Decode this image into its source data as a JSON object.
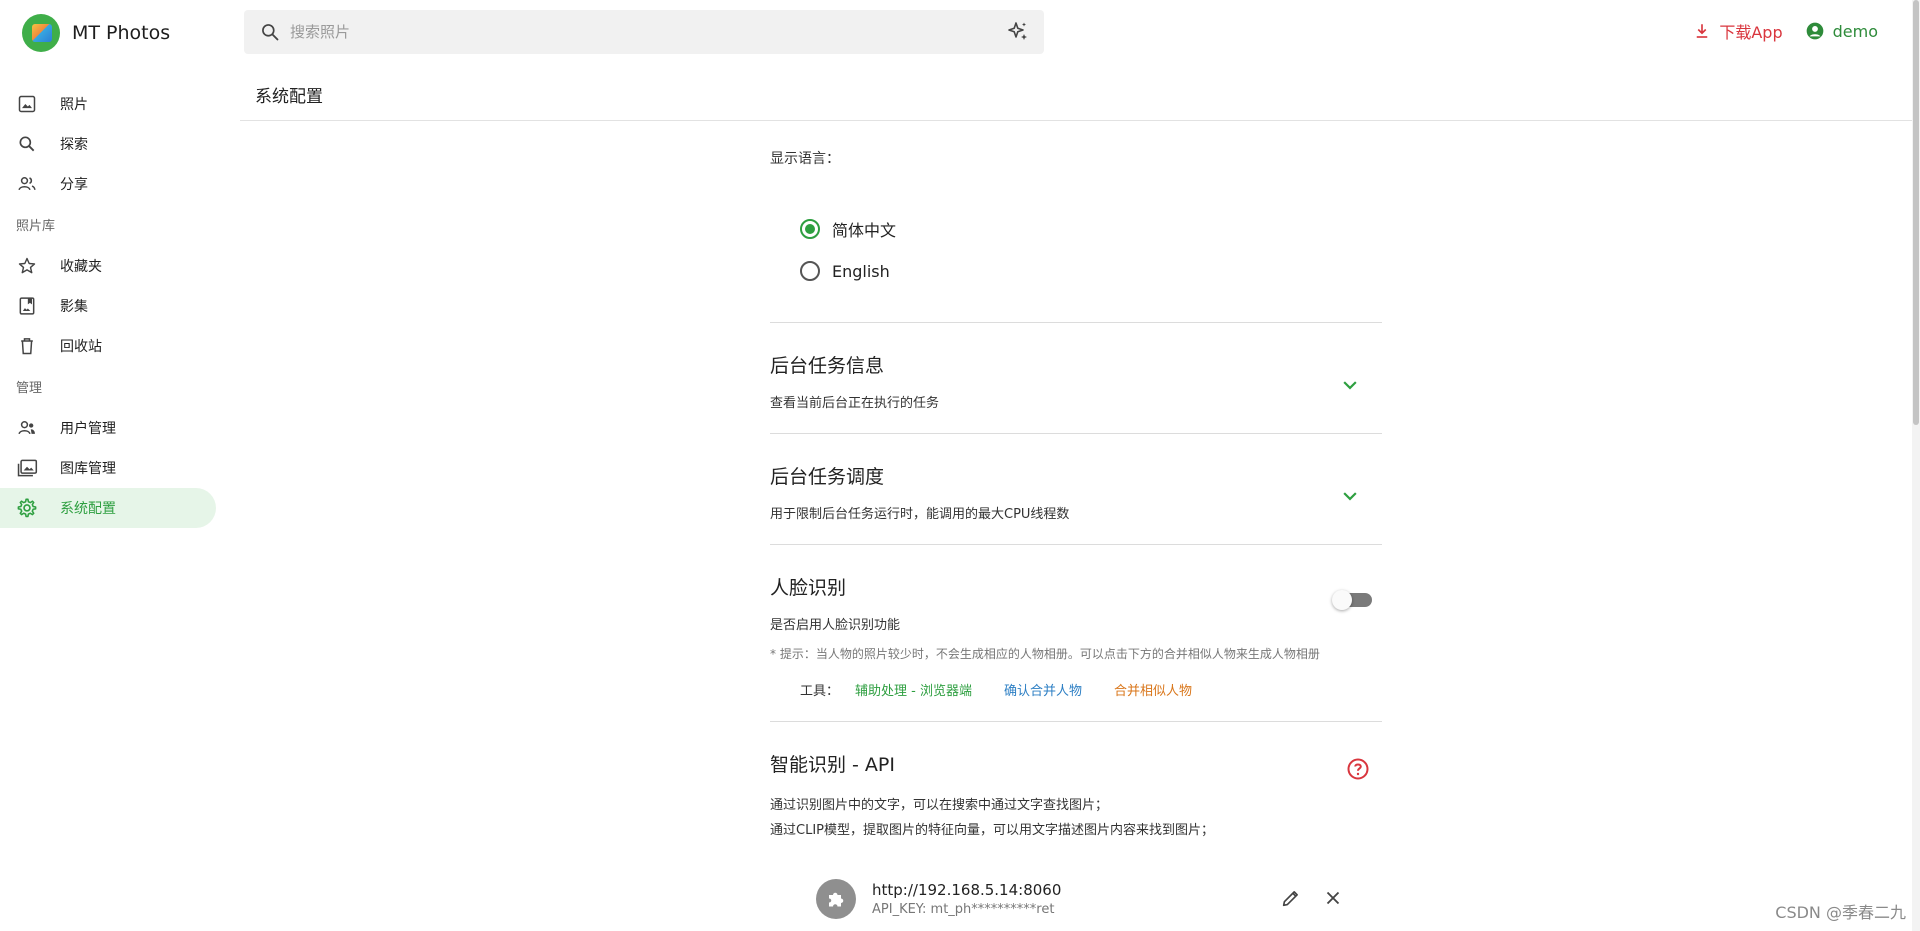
{
  "app": {
    "title": "MT Photos"
  },
  "search": {
    "placeholder": "搜索照片"
  },
  "header": {
    "download_label": "下载App",
    "user_name": "demo"
  },
  "sidebar": {
    "main": [
      {
        "label": "照片",
        "icon": "image-icon"
      },
      {
        "label": "探索",
        "icon": "search-icon"
      },
      {
        "label": "分享",
        "icon": "people-icon"
      }
    ],
    "library_label": "照片库",
    "library": [
      {
        "label": "收藏夹",
        "icon": "star-icon"
      },
      {
        "label": "影集",
        "icon": "album-icon"
      },
      {
        "label": "回收站",
        "icon": "trash-icon"
      }
    ],
    "admin_label": "管理",
    "admin": [
      {
        "label": "用户管理",
        "icon": "users-icon"
      },
      {
        "label": "图库管理",
        "icon": "gallery-icon"
      },
      {
        "label": "系统配置",
        "icon": "gear-icon",
        "active": true
      }
    ]
  },
  "page": {
    "title": "系统配置"
  },
  "language": {
    "label": "显示语言：",
    "options": [
      {
        "label": "简体中文",
        "checked": true
      },
      {
        "label": "English",
        "checked": false
      }
    ]
  },
  "task_info": {
    "title": "后台任务信息",
    "desc": "查看当前后台正在执行的任务"
  },
  "task_schedule": {
    "title": "后台任务调度",
    "desc": "用于限制后台任务运行时，能调用的最大CPU线程数"
  },
  "face": {
    "title": "人脸识别",
    "desc": "是否启用人脸识别功能",
    "enabled": false,
    "hint": "* 提示：当人物的照片较少时，不会生成相应的人物相册。可以点击下方的合并相似人物来生成人物相册",
    "tools_label": "工具：",
    "tools": [
      "辅助处理 - 浏览器端",
      "确认合并人物",
      "合并相似人物"
    ]
  },
  "ai_api": {
    "title": "智能识别 - API",
    "lines": [
      "通过识别图片中的文字，可以在搜索中通过文字查找图片；",
      "通过CLIP模型，提取图片的特征向量，可以用文字描述图片内容来找到图片；"
    ],
    "server": {
      "url": "http://192.168.5.14:8060",
      "api_key": "API_KEY: mt_ph**********ret"
    }
  },
  "colors": {
    "accent": "#2e9f40",
    "download": "#d9363e",
    "link_blue": "#2d7fc4",
    "link_orange": "#d9761a"
  },
  "watermark": "CSDN @季春二九"
}
